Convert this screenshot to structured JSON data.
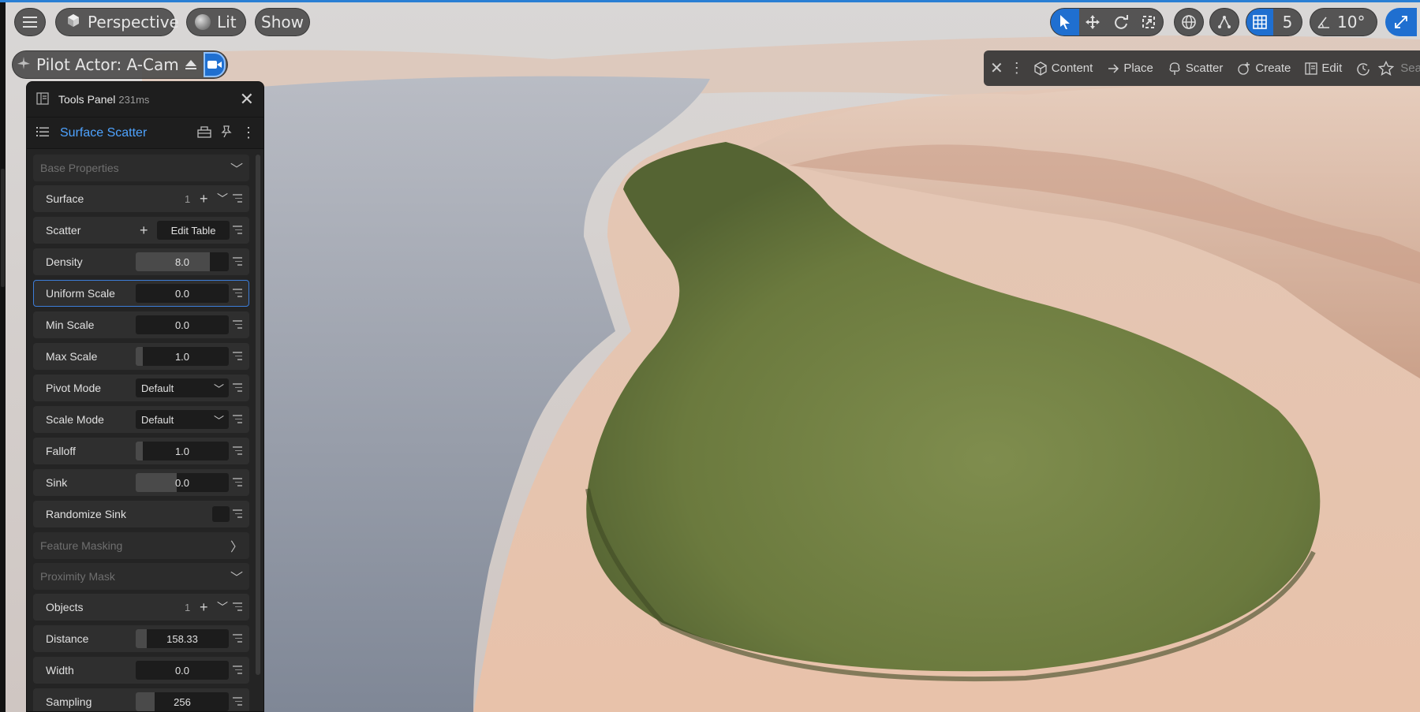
{
  "viewport": {
    "view_mode": "Perspective",
    "lighting_mode": "Lit",
    "show_label": "Show",
    "pilot_label": "Pilot Actor: A-Cam",
    "grid_snap_value": "5",
    "angle_snap_value": "10°"
  },
  "mode_toolbar": {
    "items": [
      {
        "label": "Content",
        "icon": "cube-outline-icon"
      },
      {
        "label": "Place",
        "icon": "arrow-right-icon"
      },
      {
        "label": "Scatter",
        "icon": "tree-icon"
      },
      {
        "label": "Create",
        "icon": "plus-circle-icon"
      },
      {
        "label": "Edit",
        "icon": "edit-panel-icon"
      }
    ],
    "search_label": "Sear"
  },
  "tools_panel": {
    "title": "Tools Panel",
    "timing": "231ms",
    "tool_name": "Surface Scatter",
    "sections": {
      "base_properties": "Base Properties",
      "feature_masking": "Feature Masking",
      "proximity_mask": "Proximity Mask"
    },
    "rows": {
      "surface": {
        "label": "Surface",
        "count": "1"
      },
      "scatter": {
        "label": "Scatter",
        "button": "Edit Table"
      },
      "density": {
        "label": "Density",
        "value": "8.0",
        "fill": 0.8
      },
      "uniform_scale": {
        "label": "Uniform Scale",
        "value": "0.0",
        "fill": 0.0
      },
      "min_scale": {
        "label": "Min Scale",
        "value": "0.0",
        "fill": 0.0
      },
      "max_scale": {
        "label": "Max Scale",
        "value": "1.0",
        "fill": 0.08
      },
      "pivot_mode": {
        "label": "Pivot Mode",
        "value": "Default"
      },
      "scale_mode": {
        "label": "Scale Mode",
        "value": "Default"
      },
      "falloff": {
        "label": "Falloff",
        "value": "1.0",
        "fill": 0.08
      },
      "sink": {
        "label": "Sink",
        "value": "0.0",
        "fill": 0.44
      },
      "randomize_sink": {
        "label": "Randomize Sink"
      },
      "objects": {
        "label": "Objects",
        "count": "1"
      },
      "distance": {
        "label": "Distance",
        "value": "158.33",
        "fill": 0.12
      },
      "width": {
        "label": "Width",
        "value": "0.0",
        "fill": 0.0
      },
      "sampling": {
        "label": "Sampling",
        "value": "256",
        "fill": 0.2
      }
    }
  },
  "colors": {
    "accent": "#1f6fd0",
    "tool_name": "#4ea3ff",
    "panel_bg": "#242424"
  }
}
